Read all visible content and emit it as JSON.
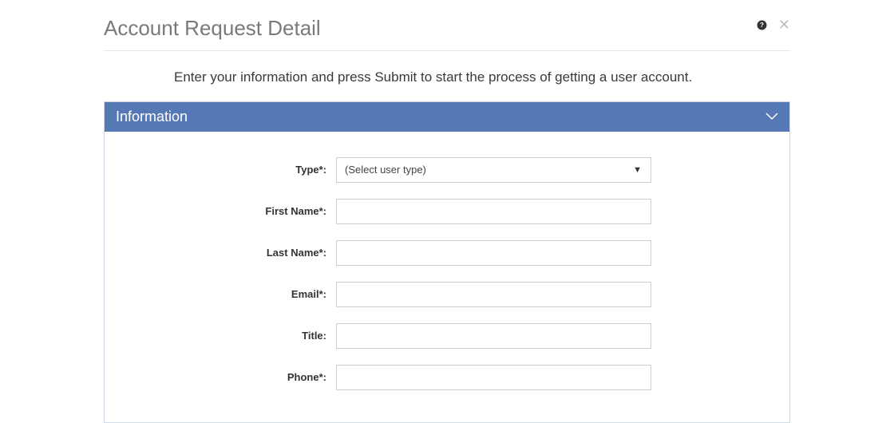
{
  "header": {
    "title": "Account Request Detail"
  },
  "instruction": "Enter your information and press Submit to start the process of getting a user account.",
  "panel": {
    "title": "Information"
  },
  "form": {
    "type": {
      "label": "Type*:",
      "selected": "(Select user type)"
    },
    "firstName": {
      "label": "First Name*:",
      "value": ""
    },
    "lastName": {
      "label": "Last Name*:",
      "value": ""
    },
    "email": {
      "label": "Email*:",
      "value": ""
    },
    "title": {
      "label": "Title:",
      "value": ""
    },
    "phone": {
      "label": "Phone*:",
      "value": ""
    }
  }
}
